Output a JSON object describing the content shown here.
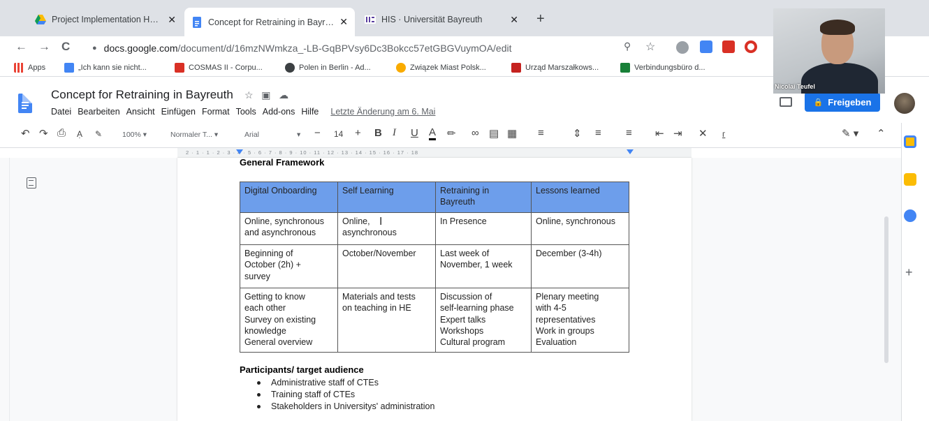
{
  "browser": {
    "tabs": [
      {
        "title": "Project Implementation Handbo",
        "close": "✕"
      },
      {
        "title": "Concept for Retraining in Bayreu",
        "close": "✕"
      },
      {
        "title": "HIS · Universität Bayreuth",
        "close": "✕"
      }
    ],
    "new_tab": "+",
    "nav": {
      "back": "←",
      "forward": "→",
      "reload": "C"
    },
    "url_host": "docs.google.com",
    "url_path": "/document/d/16mzNWmkza_-LB-GqBPVsy6Dc3Bokcc57etGBGVuymOA/edit",
    "bookmarks": [
      {
        "label": "Apps",
        "color": "#ea4335"
      },
      {
        "label": "„Ich kann sie nicht...",
        "color": "#4285f4"
      },
      {
        "label": "COSMAS II - Corpu...",
        "color": "#d93025"
      },
      {
        "label": "Polen in Berlin - Ad...",
        "color": "#3c4043"
      },
      {
        "label": "Związek Miast Polsk...",
        "color": "#f9ab00"
      },
      {
        "label": "Urząd Marszałkows...",
        "color": "#c5221f"
      },
      {
        "label": "Verbindungsbüro d...",
        "color": "#188038"
      }
    ]
  },
  "video": {
    "name": "Nicolai Teufel"
  },
  "docs": {
    "title": "Concept for Retraining in Bayreuth",
    "menu": [
      "Datei",
      "Bearbeiten",
      "Ansicht",
      "Einfügen",
      "Format",
      "Tools",
      "Add-ons",
      "Hilfe"
    ],
    "last_edit": "Letzte Änderung am 6. Mai",
    "share": "Freigeben",
    "toolbar": {
      "zoom": "100%",
      "style": "Normaler T...",
      "font": "Arial",
      "size": "14"
    },
    "ruler_marks": "2 · 1 · 1 · 2 · 3 · 4 · 5 · 6 · 7 · 8 · 9 · 10 · 11 · 12 · 13 · 14 · 15 · 16 · 17 · 18"
  },
  "document": {
    "heading": "General Framework",
    "table": {
      "headers": [
        [
          "Digital Onboarding"
        ],
        [
          "Self Learning"
        ],
        [
          "Retraining in",
          "Bayreuth"
        ],
        [
          "Lessons learned"
        ]
      ],
      "rows": [
        [
          [
            "Online, synchronous",
            "and asynchronous"
          ],
          [
            "Online,",
            "asynchronous"
          ],
          [
            "In Presence"
          ],
          [
            "Online, synchronous"
          ]
        ],
        [
          [
            "Beginning of",
            "October (2h) +",
            "survey"
          ],
          [
            "October/November"
          ],
          [
            "Last week of",
            "November, 1 week"
          ],
          [
            "December (3-4h)"
          ]
        ],
        [
          [
            "Getting to know",
            "each other",
            "Survey on existing",
            "knowledge",
            "General overview"
          ],
          [
            "Materials and tests",
            "on teaching in HE"
          ],
          [
            "Discussion of",
            "self-learning phase",
            "Expert talks",
            "Workshops",
            "Cultural program"
          ],
          [
            "Plenary meeting",
            "with 4-5",
            "representatives",
            "Work in groups",
            "Evaluation"
          ]
        ]
      ]
    },
    "participants_heading": "Participants/ target audience",
    "participants": [
      "Administrative staff of CTEs",
      "Training staff of CTEs",
      "Stakeholders in Universitys' administration"
    ]
  }
}
